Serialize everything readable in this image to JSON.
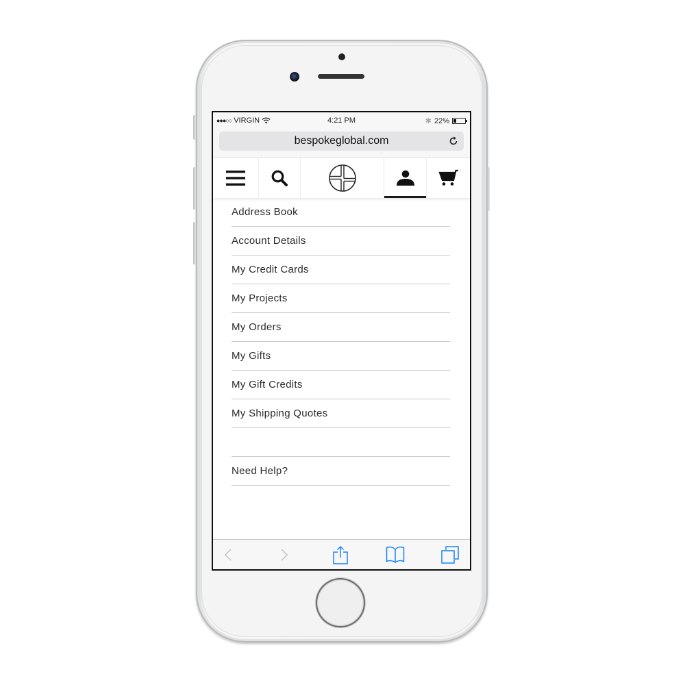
{
  "status_bar": {
    "carrier": "VIRGIN",
    "signal_bars_filled": 3,
    "signal_bars_total": 5,
    "time": "4:21 PM",
    "battery_percent_label": "22%",
    "battery_level": 0.22,
    "icons": [
      "wifi-icon",
      "bluetooth-icon",
      "battery-icon"
    ]
  },
  "browser": {
    "url": "bespokeglobal.com",
    "reload_icon": "reload-icon",
    "toolbar": {
      "back_icon": "chevron-left-icon",
      "forward_icon": "chevron-right-icon",
      "share_icon": "share-icon",
      "bookmarks_icon": "book-icon",
      "tabs_icon": "tabs-icon"
    },
    "accent_color": "#1a82fb",
    "disabled_color": "#c2c2c2"
  },
  "site_nav": {
    "items": [
      {
        "name": "menu",
        "icon": "hamburger-icon"
      },
      {
        "name": "search",
        "icon": "search-icon"
      },
      {
        "name": "logo",
        "icon": "bespoke-logo-icon"
      },
      {
        "name": "account",
        "icon": "user-icon",
        "active": true
      },
      {
        "name": "cart",
        "icon": "cart-icon"
      }
    ]
  },
  "account_menu": {
    "items": [
      {
        "label": "Address Book"
      },
      {
        "label": "Account Details"
      },
      {
        "label": "My Credit Cards"
      },
      {
        "label": "My Projects"
      },
      {
        "label": "My Orders"
      },
      {
        "label": "My Gifts"
      },
      {
        "label": "My Gift Credits"
      },
      {
        "label": "My Shipping Quotes"
      }
    ],
    "help_label": "Need Help?"
  }
}
